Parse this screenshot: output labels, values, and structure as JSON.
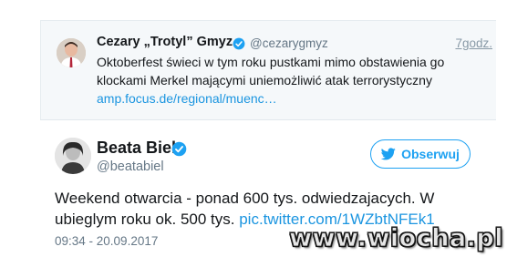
{
  "quoted_tweet": {
    "author_name": "Cezary „Trotyl” Gmyz",
    "handle": "@cezarygmyz",
    "time": "7godz.",
    "text": "Oktoberfest świeci w tym roku pustkami mimo obstawienia go klockami Merkel mającymi uniemożliwić atak terrorystyczny",
    "link": "amp.focus.de/regional/muenc…",
    "verified": true,
    "avatar_icon": "user-avatar"
  },
  "main_tweet": {
    "author_name": "Beata Biel",
    "handle": "@beatabiel",
    "verified": true,
    "follow_button_label": "Obserwuj",
    "text": "Weekend otwarcia - ponad 600 tys. odwiedzajacych. W ubieglym roku ok. 500 tys.",
    "link": "pic.twitter.com/1WZbtNFEk1",
    "date": "09:34 - 20.09.2017",
    "avatar_icon": "user-avatar"
  },
  "watermark": "www.wiocha.pl",
  "colors": {
    "twitter_blue": "#1da1f2",
    "link_blue": "#1b95e0",
    "muted_gray": "#657786",
    "quoted_bg": "#f5f8fa"
  }
}
